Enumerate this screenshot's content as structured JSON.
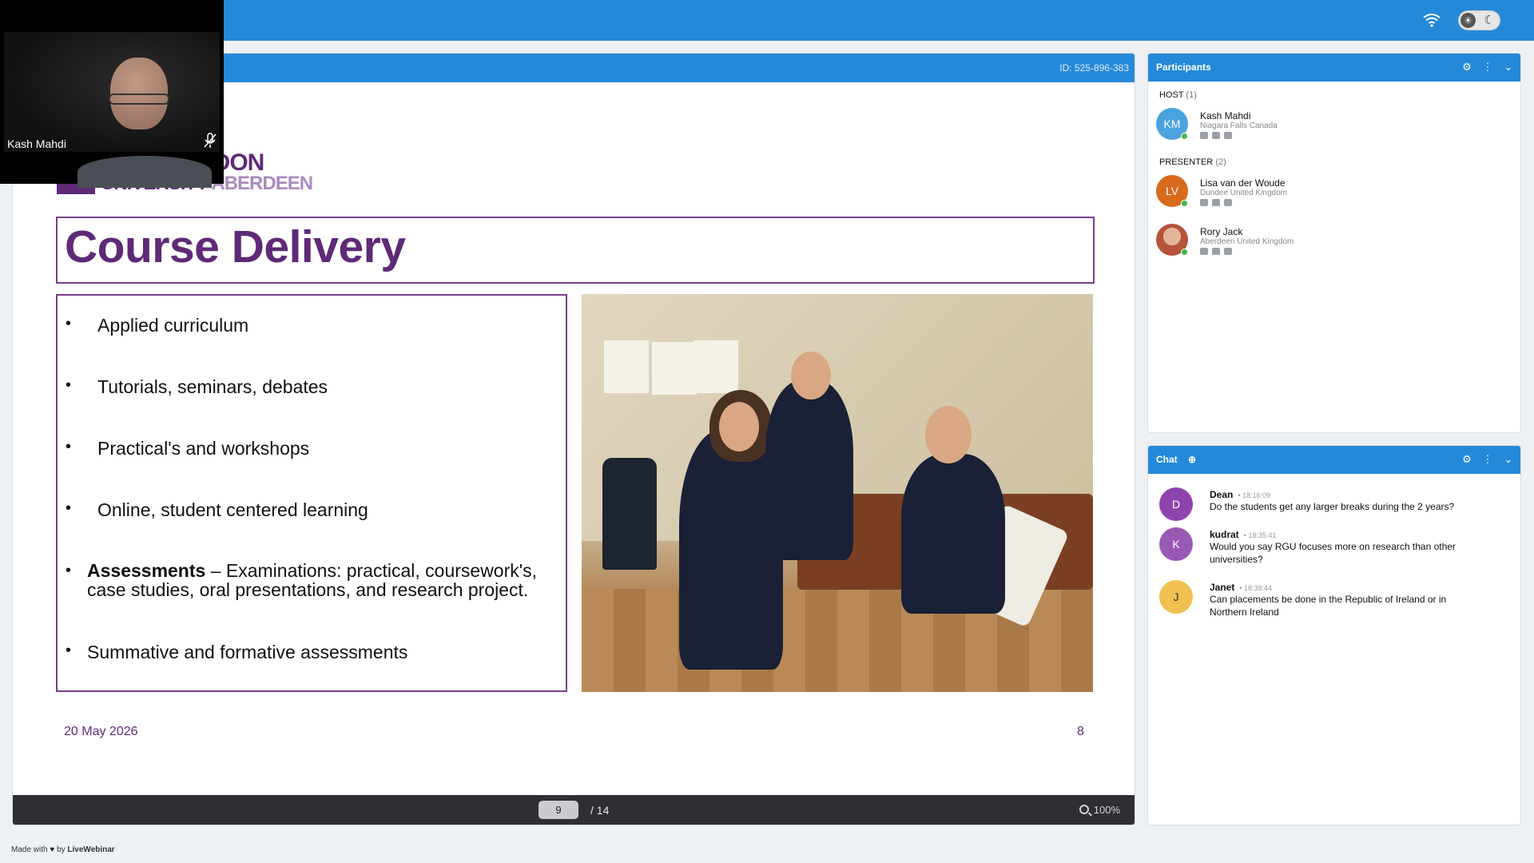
{
  "room_id": "ID: 525-896-383",
  "webcam": {
    "name": "Kash Mahdi"
  },
  "slide": {
    "logo_line1": "RDON",
    "logo_line2_a": "UNIVERSITY",
    "logo_line2_b": "ABERDEEN",
    "title": "Course Delivery",
    "bullets": [
      {
        "text": "Applied curriculum"
      },
      {
        "text": "Tutorials, seminars, debates"
      },
      {
        "text": "Practical's and workshops"
      },
      {
        "text": "Online, student centered learning"
      },
      {
        "bold": "Assessments",
        "text": " – Examinations: practical, coursework's, case studies, oral presentations, and research project."
      },
      {
        "text": "Summative and formative assessments"
      }
    ],
    "date": "20 May 2026",
    "number": "8"
  },
  "viewer": {
    "current_page": "9",
    "total_pages": "/ 14",
    "zoom": "100%"
  },
  "participants": {
    "title": "Participants",
    "groups": [
      {
        "label": "HOST",
        "count": "(1)"
      },
      {
        "label": "PRESENTER",
        "count": "(2)"
      }
    ],
    "people": [
      {
        "initials": "KM",
        "name": "Kash Mahdi",
        "location": "Niagara Falls Canada",
        "color": "#4aa3df"
      },
      {
        "initials": "LV",
        "name": "Lisa van der Woude",
        "location": "Dundee United Kingdom",
        "color": "#d86a1c"
      },
      {
        "initials": "",
        "name": "Rory Jack",
        "location": "Aberdeen United Kingdom",
        "color": "#b56a4e"
      }
    ]
  },
  "chat": {
    "title": "Chat",
    "messages": [
      {
        "initial": "D",
        "author": "Dean",
        "time": "• 18:16:09",
        "text": "Do the students get any larger breaks during the 2 years?",
        "color": "#8e44ad"
      },
      {
        "initial": "K",
        "author": "kudrat",
        "time": "• 18:35:41",
        "text": "Would you say RGU focuses more on research than other universities?",
        "color": "#9b59b6"
      },
      {
        "initial": "J",
        "author": "Janet",
        "time": "• 18:38:44",
        "text": "Can placements be done in the Republic of Ireland or in Northern Ireland",
        "color": "#f0c050"
      }
    ]
  },
  "footer": {
    "made_with": "Made with",
    "by": "by",
    "brand": "LiveWebinar"
  },
  "colors": {
    "brand_blue": "#2589d9",
    "slide_purple": "#5e2a77"
  }
}
